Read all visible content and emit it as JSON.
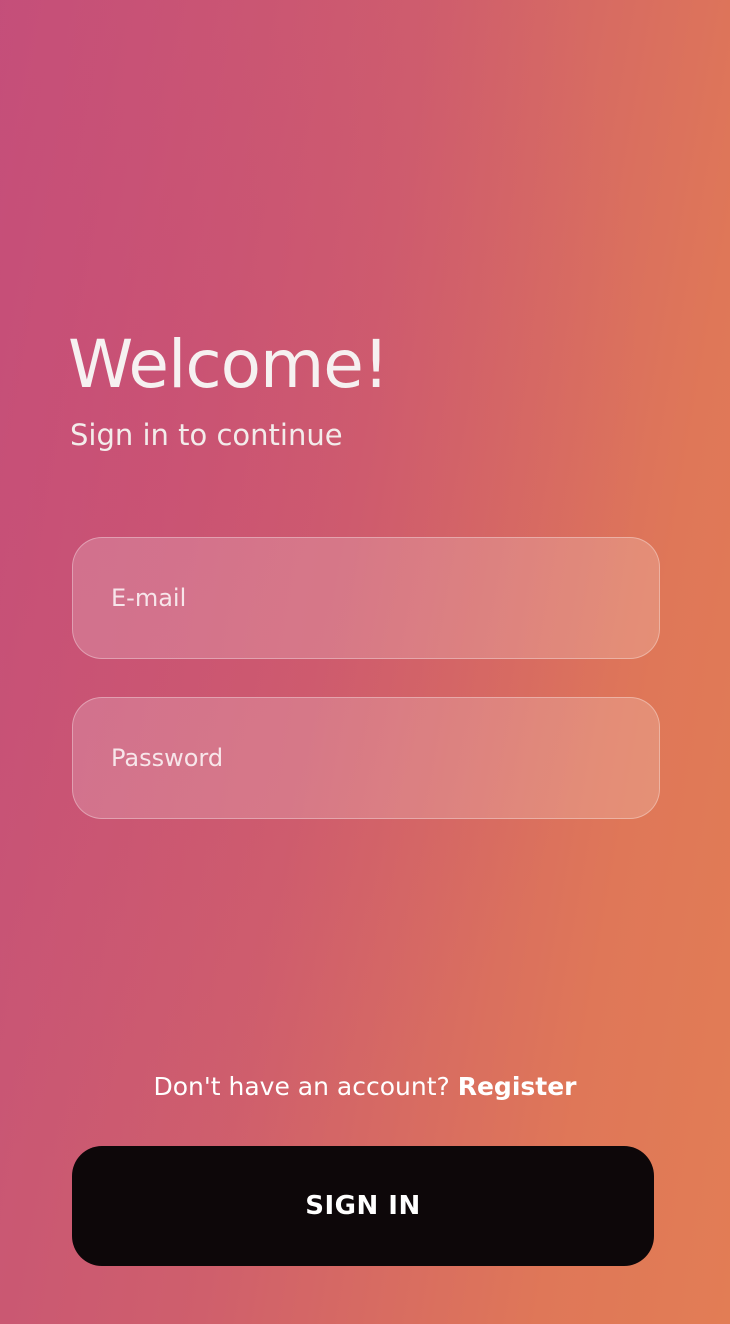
{
  "header": {
    "title": "Welcome!",
    "subtitle": "Sign in to continue"
  },
  "form": {
    "email": {
      "placeholder": "E-mail",
      "value": ""
    },
    "password": {
      "placeholder": "Password",
      "value": ""
    }
  },
  "footer": {
    "register_prompt": "Don't have an account?",
    "register_link": "Register",
    "signin_label": "SIGN IN"
  },
  "colors": {
    "background_start": "#c4507a",
    "background_end": "#e27d55",
    "button_bg": "#0d0709",
    "text": "#ffffff"
  }
}
